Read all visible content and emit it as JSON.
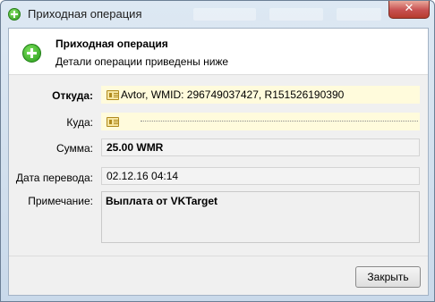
{
  "window": {
    "title": "Приходная операция",
    "close_glyph": "✕"
  },
  "header": {
    "title": "Приходная операция",
    "subtitle": "Детали операции приведены ниже"
  },
  "fields": {
    "from_label": "Откуда:",
    "from_value": "Avtor, WMID: 296749037427, R151526190390",
    "to_label": "Куда:",
    "amount_label": "Сумма:",
    "amount_value": "25.00 WMR",
    "date_label": "Дата перевода:",
    "date_value": "02.12.16 04:14",
    "note_label": "Примечание:",
    "note_value": "Выплата от VKTarget"
  },
  "footer": {
    "close_label": "Закрыть"
  },
  "icons": {
    "title_icon": "green-plus-icon",
    "header_icon": "green-plus-icon",
    "wmid_icon": "id-card-icon"
  },
  "colors": {
    "accent_green": "#2e9a1d",
    "field_highlight": "#fffbdc",
    "close_red": "#c75050"
  }
}
